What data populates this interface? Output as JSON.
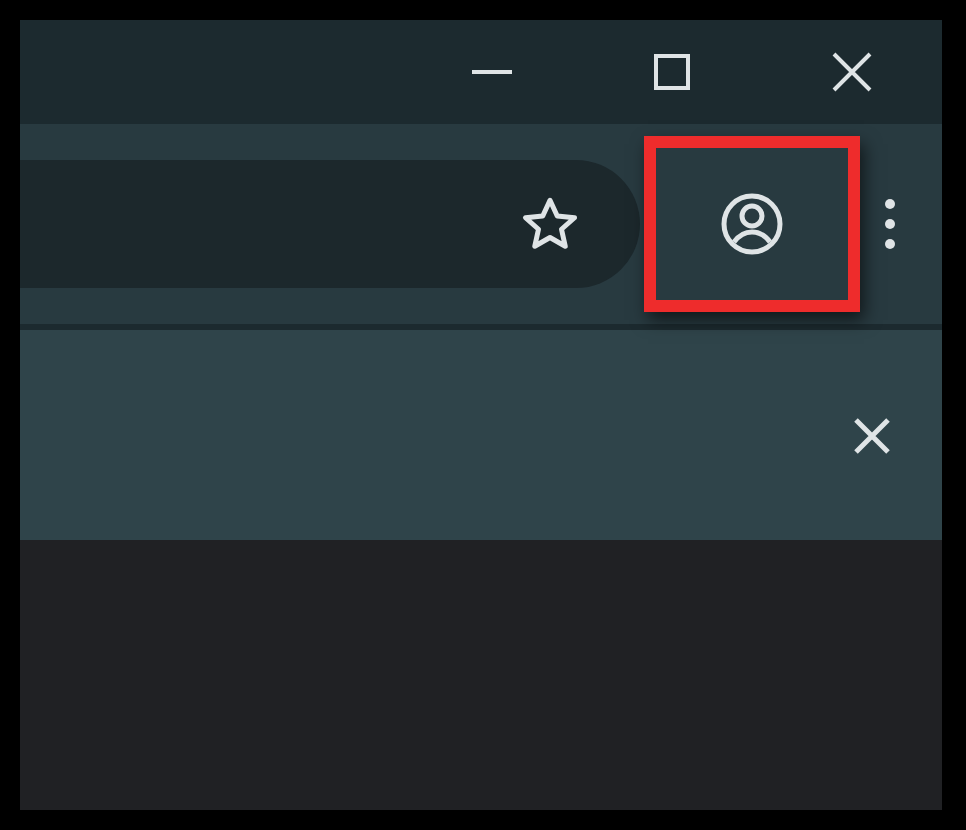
{
  "window_controls": [
    {
      "kind": "minimize"
    },
    {
      "kind": "maximize"
    },
    {
      "kind": "close"
    }
  ],
  "toolbar": {
    "items": [
      {
        "kind": "profile",
        "highlighted": true
      },
      {
        "kind": "menu"
      }
    ]
  },
  "address_bar": {
    "bookmarked": false
  },
  "infobar": {
    "closable": true
  }
}
